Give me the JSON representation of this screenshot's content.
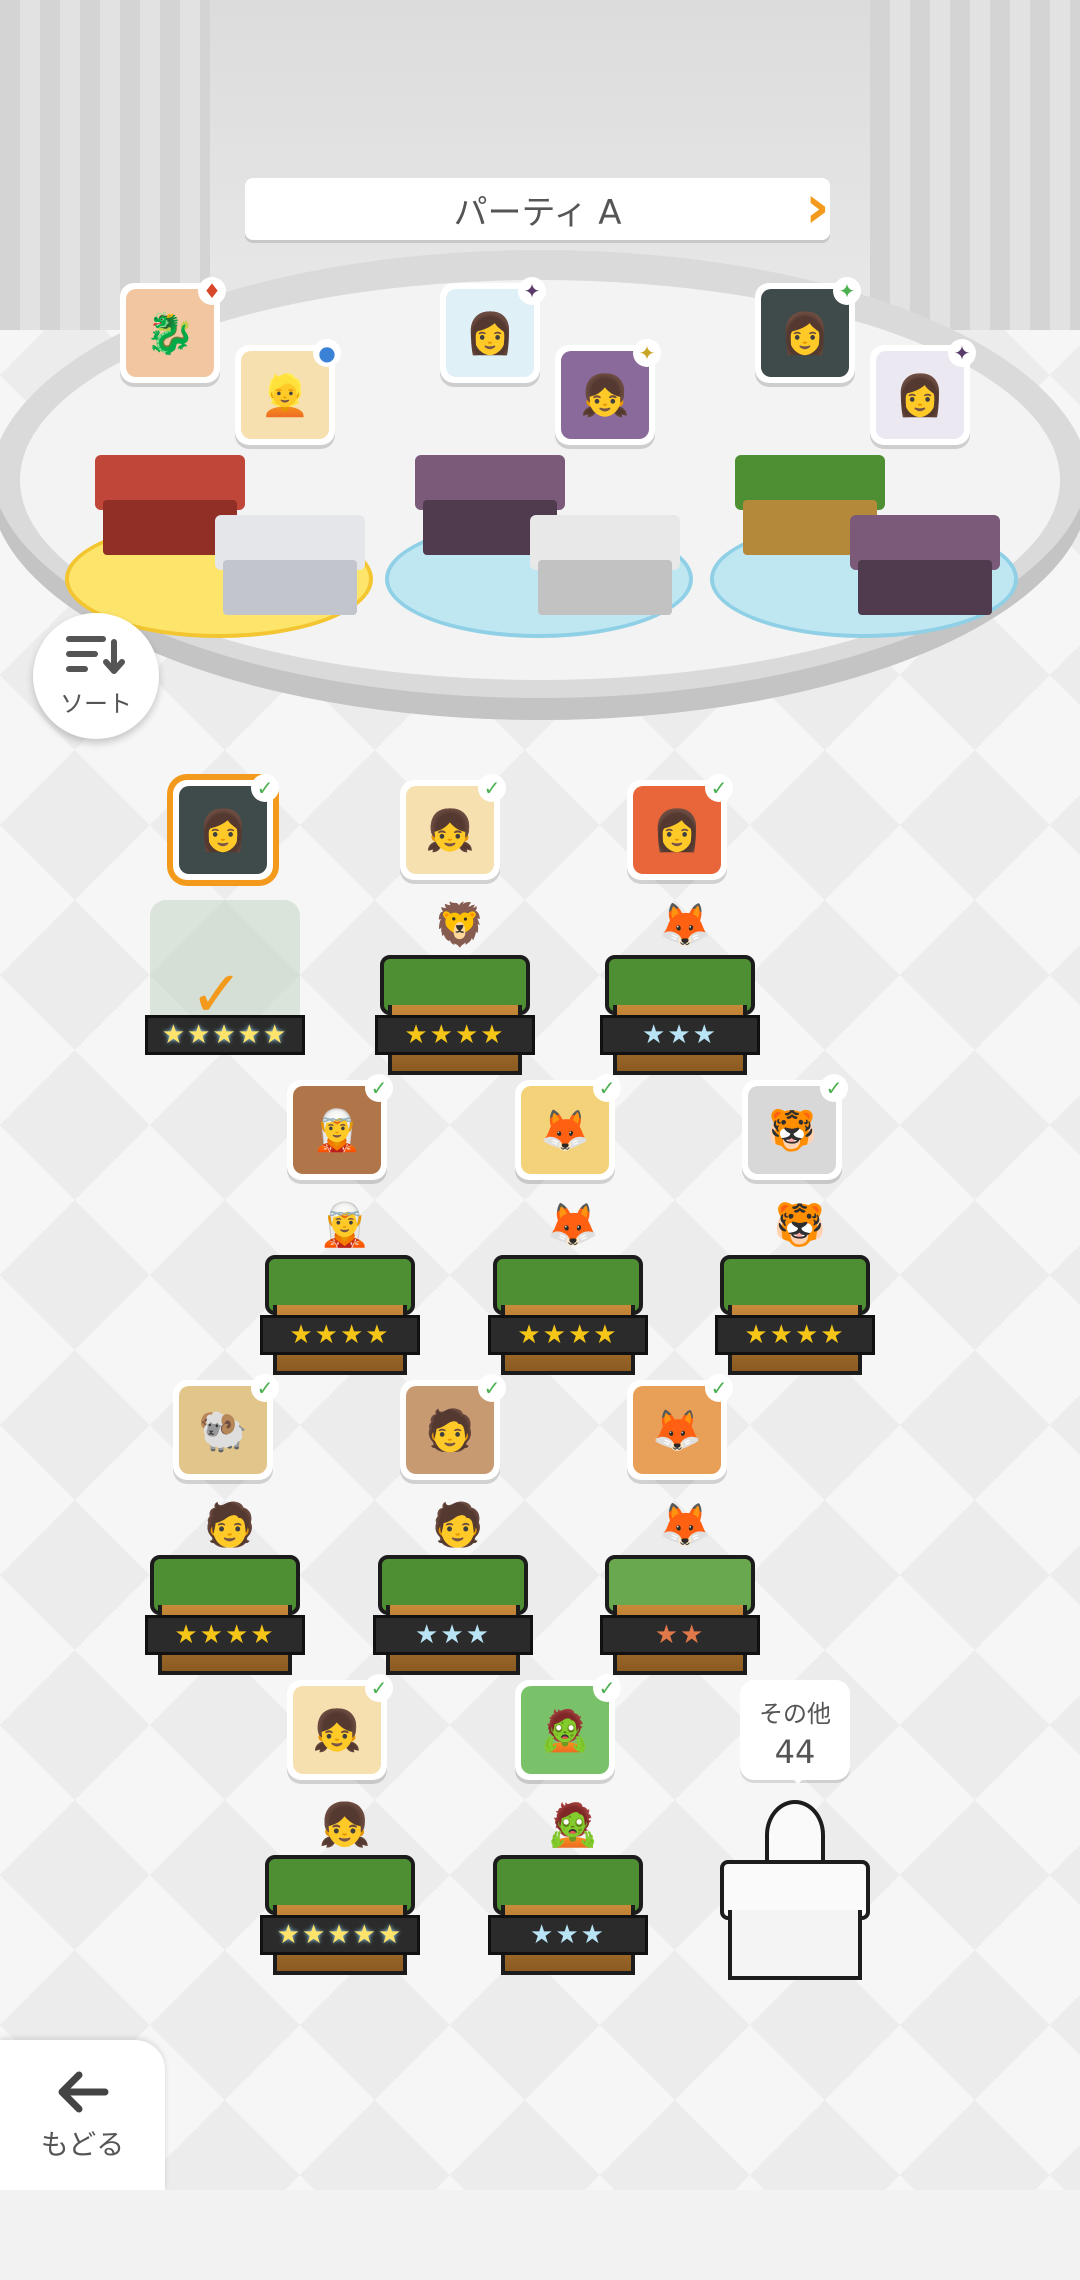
{
  "header": {
    "party_title": "パーティ A",
    "prev_icon": "chevron-left-icon",
    "next_icon": "chevron-right-icon"
  },
  "party": {
    "slots": [
      {
        "members": [
          {
            "portrait": "🐉",
            "element": "♦",
            "color": "#d9472b"
          },
          {
            "portrait": "👱",
            "element": "●",
            "color": "#3b82d6"
          }
        ]
      },
      {
        "members": [
          {
            "portrait": "👩",
            "element": "✦",
            "color": "#5b3b6b"
          },
          {
            "portrait": "👧",
            "element": "✦",
            "color": "#c8a628"
          }
        ]
      },
      {
        "members": [
          {
            "portrait": "👩",
            "element": "✦",
            "color": "#4caf50"
          },
          {
            "portrait": "👩",
            "element": "✦",
            "color": "#5b3b6b"
          }
        ]
      }
    ]
  },
  "sort_button": {
    "label": "ソート",
    "icon": "sort-icon"
  },
  "roster": [
    {
      "portrait": "👩",
      "stars": "★★★★★",
      "rank": 5,
      "selected": true
    },
    {
      "portrait": "👧",
      "stars": "★★★★",
      "rank": 4
    },
    {
      "portrait": "👩",
      "stars": "★★★",
      "rank": 3
    },
    {
      "portrait": "🧝",
      "stars": "★★★★",
      "rank": 4
    },
    {
      "portrait": "🦊",
      "stars": "★★★★",
      "rank": 4
    },
    {
      "portrait": "🐯",
      "stars": "★★★★",
      "rank": 4
    },
    {
      "portrait": "🐏",
      "stars": "★★★★",
      "rank": 4
    },
    {
      "portrait": "🧑",
      "stars": "★★★",
      "rank": 3
    },
    {
      "portrait": "🦊",
      "stars": "★★",
      "rank": 2
    },
    {
      "portrait": "👧",
      "stars": "★★★★★",
      "rank": 5
    },
    {
      "portrait": "🧟",
      "stars": "★★★",
      "rank": 3
    }
  ],
  "others": {
    "label": "その他",
    "count": "44"
  },
  "back_button": {
    "label": "もどる",
    "icon": "arrow-left-icon"
  },
  "colors": {
    "accent": "#f39a1c",
    "grass": "#4e8f33"
  }
}
